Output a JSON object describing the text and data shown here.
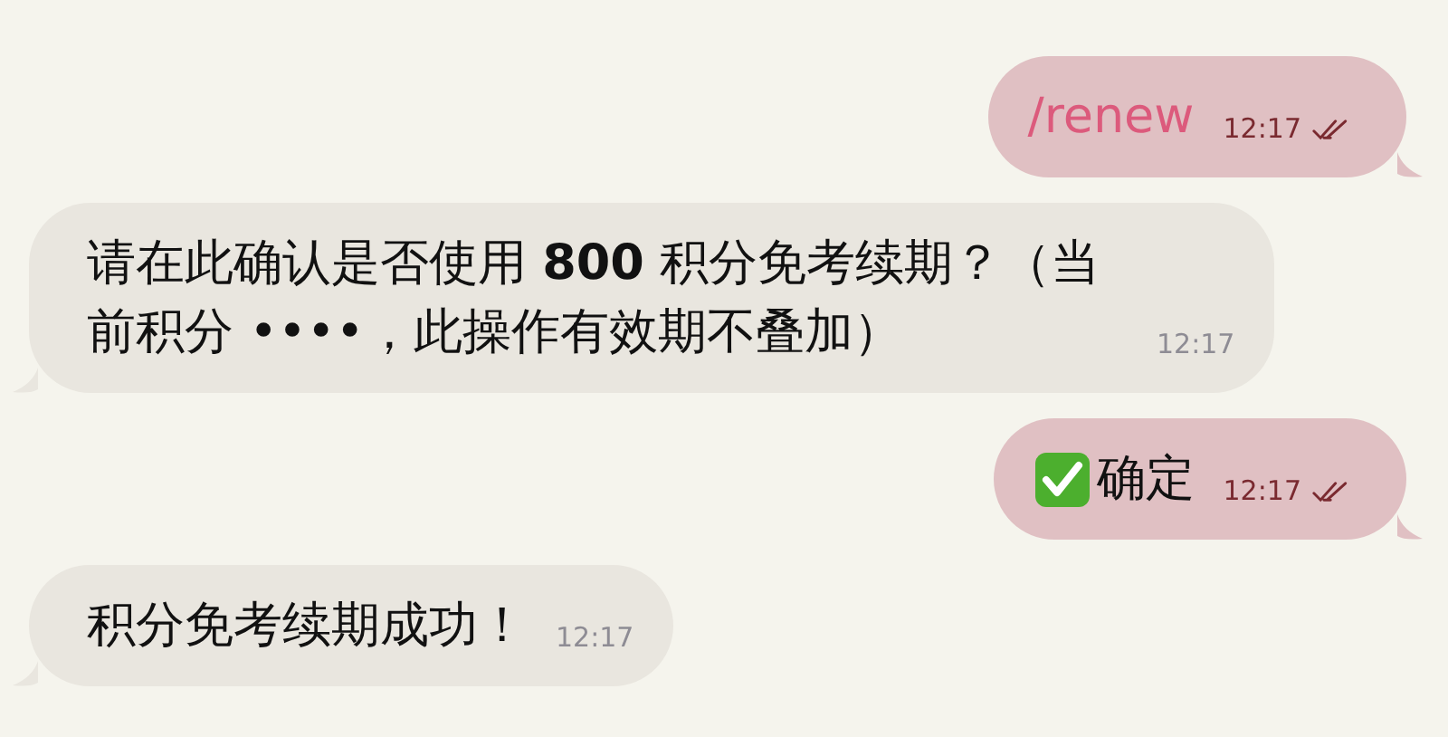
{
  "messages": [
    {
      "outgoing": true,
      "kind": "command",
      "text": "/renew",
      "time": "12:17",
      "read": true
    },
    {
      "outgoing": false,
      "kind": "text",
      "text": "请在此确认是否使用 **800** 积分免考续期？（当前积分 ••••，此操作有效期不叠加）",
      "time": "12:17"
    },
    {
      "outgoing": true,
      "kind": "confirm",
      "text": "确定",
      "time": "12:17",
      "read": true
    },
    {
      "outgoing": false,
      "kind": "text",
      "text": "积分免考续期成功！",
      "time": "12:17"
    }
  ]
}
